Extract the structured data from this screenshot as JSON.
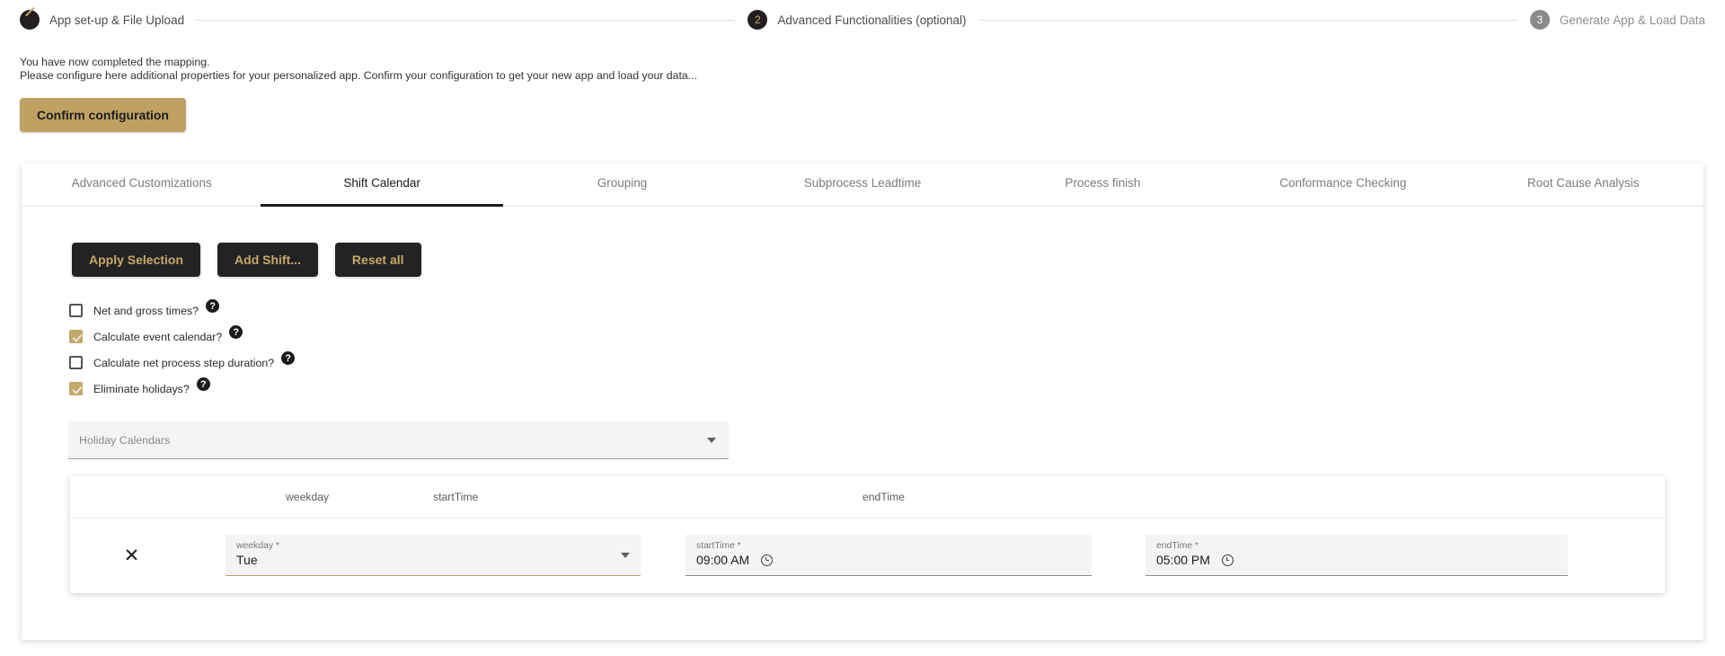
{
  "stepper": {
    "steps": [
      {
        "marker": "pencil-icon",
        "label": "App set-up & File Upload",
        "state": "done"
      },
      {
        "marker": "2",
        "label": "Advanced Functionalities (optional)",
        "state": "active"
      },
      {
        "marker": "3",
        "label": "Generate App & Load Data",
        "state": "todo"
      }
    ]
  },
  "intro": {
    "line1": "You have now completed the mapping.",
    "line2": "Please configure here additional properties for your personalized app. Confirm your configuration to get your new app and load your data...",
    "confirm_label": "Confirm configuration"
  },
  "tabs": [
    {
      "label": "Advanced Customizations",
      "active": false
    },
    {
      "label": "Shift Calendar",
      "active": true
    },
    {
      "label": "Grouping",
      "active": false
    },
    {
      "label": "Subprocess Leadtime",
      "active": false
    },
    {
      "label": "Process finish",
      "active": false
    },
    {
      "label": "Conformance Checking",
      "active": false
    },
    {
      "label": "Root Cause Analysis",
      "active": false
    }
  ],
  "actions": {
    "apply": "Apply Selection",
    "add_shift": "Add Shift...",
    "reset": "Reset all"
  },
  "checkboxes": [
    {
      "label": "Net and gross times?",
      "checked": false,
      "help": "?"
    },
    {
      "label": "Calculate event calendar?",
      "checked": true,
      "help": "?"
    },
    {
      "label": "Calculate net process step duration?",
      "checked": false,
      "help": "?"
    },
    {
      "label": "Eliminate holidays?",
      "checked": true,
      "help": "?"
    }
  ],
  "holiday_select": {
    "placeholder": "Holiday Calendars",
    "value": ""
  },
  "shift_table": {
    "columns": [
      "weekday",
      "startTime",
      "endTime"
    ],
    "rows": [
      {
        "remove": "✕",
        "weekday_label": "weekday *",
        "weekday_value": "Tue",
        "starttime_label": "startTime *",
        "starttime_value": "09:00 AM",
        "endtime_label": "endTime *",
        "endtime_value": "05:00 PM"
      }
    ]
  },
  "colors": {
    "accent_gold": "#bfa263",
    "dark": "#232323",
    "button_text_gold": "#c7a86a"
  }
}
